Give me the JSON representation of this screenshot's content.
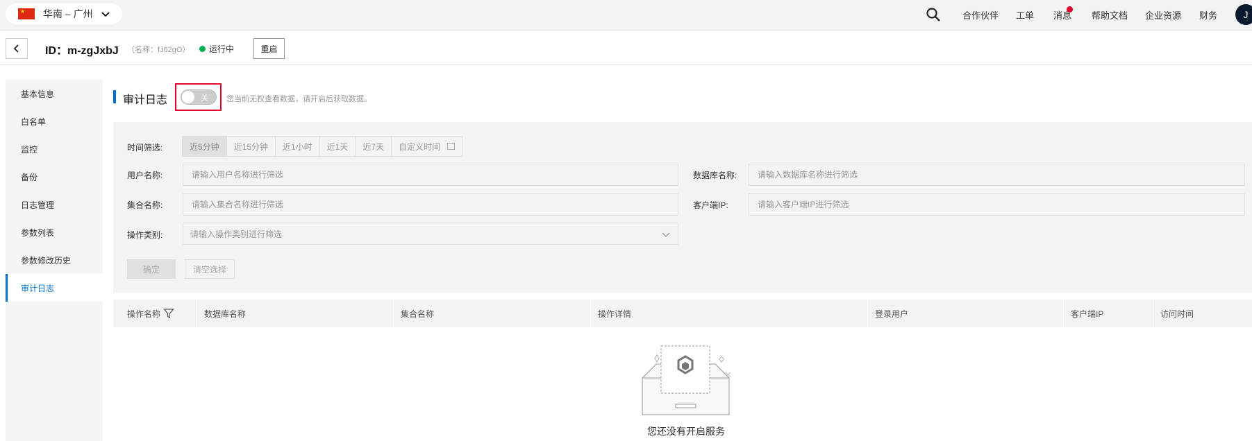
{
  "topbar": {
    "region_label": "华南 – 广州",
    "nav": [
      "合作伙伴",
      "工单",
      "消息",
      "帮助文档",
      "企业资源",
      "财务"
    ],
    "avatar_letter": "J"
  },
  "header": {
    "instance_id": "ID：m-zgJxbJ",
    "instance_name": "（名称：fJ62gO）",
    "status": "运行中",
    "restart_label": "重启"
  },
  "sidebar": {
    "items": [
      "基本信息",
      "白名单",
      "监控",
      "备份",
      "日志管理",
      "参数列表",
      "参数修改历史",
      "审计日志"
    ],
    "active_index": 7
  },
  "section": {
    "title": "审计日志",
    "toggle_label": "关",
    "toggle_on": false,
    "notice": "您当前无权查看数据，请开启后获取数据。"
  },
  "filters": {
    "time_label": "时间筛选:",
    "time_options": [
      "近5分钟",
      "近15分钟",
      "近1小时",
      "近1天",
      "近7天",
      "自定义时间"
    ],
    "selected_time_index": 0,
    "user_label": "用户名称:",
    "user_placeholder": "请输入用户名称进行筛选",
    "db_label": "数据库名称:",
    "db_placeholder": "请输入数据库名称进行筛选",
    "collection_label": "集合名称:",
    "collection_placeholder": "请输入集合名称进行筛选",
    "client_ip_label": "客户端IP:",
    "client_ip_placeholder": "请输入客户端IP进行筛选",
    "op_type_label": "操作类别:",
    "op_type_placeholder": "请输入操作类别进行筛选",
    "confirm_label": "确定",
    "clear_label": "清空选择"
  },
  "table": {
    "columns": [
      "操作名称",
      "数据库名称",
      "集合名称",
      "操作详情",
      "登录用户",
      "客户端IP",
      "访问时间"
    ]
  },
  "empty": {
    "text": "您还没有开启服务"
  },
  "colors": {
    "accent": "#0070cc",
    "highlight": "#e6002d",
    "status_running": "#00b050"
  }
}
